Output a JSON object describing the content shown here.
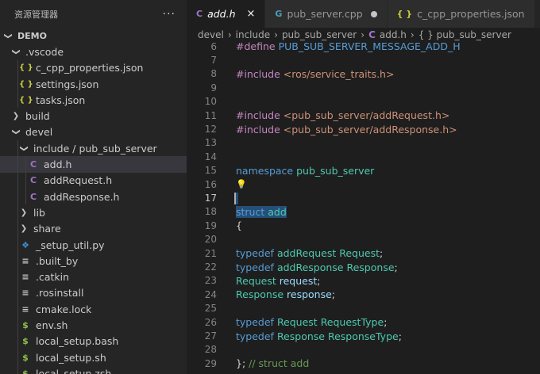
{
  "sidebar": {
    "title": "资源管理器",
    "more": "···",
    "items": [
      {
        "label": "DEMO",
        "depth": 0,
        "kind": "folder-open",
        "icon": "chevron-down-icon"
      },
      {
        "label": ".vscode",
        "depth": 1,
        "kind": "folder-open"
      },
      {
        "label": "c_cpp_properties.json",
        "depth": 2,
        "kind": "json",
        "glyph": "{ }"
      },
      {
        "label": "settings.json",
        "depth": 2,
        "kind": "json",
        "glyph": "{ }"
      },
      {
        "label": "tasks.json",
        "depth": 2,
        "kind": "json",
        "glyph": "{ }"
      },
      {
        "label": "build",
        "depth": 1,
        "kind": "folder-closed"
      },
      {
        "label": "devel",
        "depth": 1,
        "kind": "folder-open"
      },
      {
        "label": "include / pub_sub_server",
        "depth": 2,
        "kind": "folder-open"
      },
      {
        "label": "add.h",
        "depth": 3,
        "kind": "c",
        "glyph": "C",
        "selected": true
      },
      {
        "label": "addRequest.h",
        "depth": 3,
        "kind": "c",
        "glyph": "C"
      },
      {
        "label": "addResponse.h",
        "depth": 3,
        "kind": "c",
        "glyph": "C"
      },
      {
        "label": "lib",
        "depth": 2,
        "kind": "folder-closed"
      },
      {
        "label": "share",
        "depth": 2,
        "kind": "folder-closed"
      },
      {
        "label": "_setup_util.py",
        "depth": 2,
        "kind": "py",
        "glyph": "❖"
      },
      {
        "label": ".built_by",
        "depth": 2,
        "kind": "lines",
        "glyph": "≡"
      },
      {
        "label": ".catkin",
        "depth": 2,
        "kind": "lines",
        "glyph": "≡"
      },
      {
        "label": ".rosinstall",
        "depth": 2,
        "kind": "lines",
        "glyph": "≡"
      },
      {
        "label": "cmake.lock",
        "depth": 2,
        "kind": "lines",
        "glyph": "≡"
      },
      {
        "label": "env.sh",
        "depth": 2,
        "kind": "shell",
        "glyph": "$"
      },
      {
        "label": "local_setup.bash",
        "depth": 2,
        "kind": "shell",
        "glyph": "$"
      },
      {
        "label": "local_setup.sh",
        "depth": 2,
        "kind": "shell",
        "glyph": "$"
      },
      {
        "label": "local_setup.zsh",
        "depth": 2,
        "kind": "shell",
        "glyph": "$"
      }
    ]
  },
  "tabs": [
    {
      "label": "add.h",
      "glyph": "C",
      "active": true,
      "italic": true,
      "close": "×"
    },
    {
      "label": "pub_server.cpp",
      "glyph": "G",
      "modified": true
    },
    {
      "label": "c_cpp_properties.json",
      "glyph": "{ }"
    }
  ],
  "breadcrumb": {
    "parts": [
      "devel",
      "include",
      "pub_sub_server"
    ],
    "file": "add.h",
    "file_glyph": "C",
    "symbol": "{ } pub_sub_server"
  },
  "code": {
    "active_line": 17,
    "lines": [
      {
        "n": 6,
        "tokens": [
          [
            "kw-pp",
            "#define "
          ],
          [
            "macro",
            "PUB_SUB_SERVER_MESSAGE_ADD_H"
          ]
        ]
      },
      {
        "n": 7,
        "tokens": []
      },
      {
        "n": 8,
        "tokens": [
          [
            "kw-pp",
            "#include "
          ],
          [
            "inc",
            "<ros/service_traits.h>"
          ]
        ]
      },
      {
        "n": 9,
        "tokens": []
      },
      {
        "n": 10,
        "tokens": []
      },
      {
        "n": 11,
        "tokens": [
          [
            "kw-pp",
            "#include "
          ],
          [
            "inc",
            "<pub_sub_server/addRequest.h>"
          ]
        ]
      },
      {
        "n": 12,
        "tokens": [
          [
            "kw-pp",
            "#include "
          ],
          [
            "inc",
            "<pub_sub_server/addResponse.h>"
          ]
        ]
      },
      {
        "n": 13,
        "tokens": []
      },
      {
        "n": 14,
        "tokens": []
      },
      {
        "n": 15,
        "tokens": [
          [
            "kw",
            "namespace "
          ],
          [
            "ns",
            "pub_sub_server"
          ]
        ]
      },
      {
        "n": 16,
        "tokens": [],
        "bulb": "💡"
      },
      {
        "n": 17,
        "tokens": [],
        "selected": true
      },
      {
        "n": 18,
        "tokens": [
          [
            "kw",
            "struct "
          ],
          [
            "type",
            "add"
          ]
        ],
        "selected": true
      },
      {
        "n": 19,
        "tokens": [
          [
            "plain",
            "{"
          ]
        ]
      },
      {
        "n": 20,
        "tokens": []
      },
      {
        "n": 21,
        "tokens": [
          [
            "kw",
            "typedef "
          ],
          [
            "type",
            "addRequest "
          ],
          [
            "type",
            "Request"
          ],
          [
            "plain",
            ";"
          ]
        ]
      },
      {
        "n": 22,
        "tokens": [
          [
            "kw",
            "typedef "
          ],
          [
            "type",
            "addResponse "
          ],
          [
            "type",
            "Response"
          ],
          [
            "plain",
            ";"
          ]
        ]
      },
      {
        "n": 23,
        "tokens": [
          [
            "type",
            "Request "
          ],
          [
            "var",
            "request"
          ],
          [
            "plain",
            ";"
          ]
        ]
      },
      {
        "n": 24,
        "tokens": [
          [
            "type",
            "Response "
          ],
          [
            "var",
            "response"
          ],
          [
            "plain",
            ";"
          ]
        ]
      },
      {
        "n": 25,
        "tokens": []
      },
      {
        "n": 26,
        "tokens": [
          [
            "kw",
            "typedef "
          ],
          [
            "type",
            "Request "
          ],
          [
            "type",
            "RequestType"
          ],
          [
            "plain",
            ";"
          ]
        ]
      },
      {
        "n": 27,
        "tokens": [
          [
            "kw",
            "typedef "
          ],
          [
            "type",
            "Response "
          ],
          [
            "type",
            "ResponseType"
          ],
          [
            "plain",
            ";"
          ]
        ]
      },
      {
        "n": 28,
        "tokens": []
      },
      {
        "n": 29,
        "tokens": [
          [
            "plain",
            "}; "
          ],
          [
            "comment",
            "// struct add"
          ]
        ]
      }
    ]
  },
  "colors": {
    "sidebar_bg": "#252526",
    "editor_bg": "#1e1e1e",
    "selection": "#264f78",
    "keyword": "#569cd6",
    "preprocessor": "#c586c0",
    "string": "#ce9178",
    "type": "#4ec9b0",
    "variable": "#9cdcfe",
    "comment": "#6a9955"
  }
}
